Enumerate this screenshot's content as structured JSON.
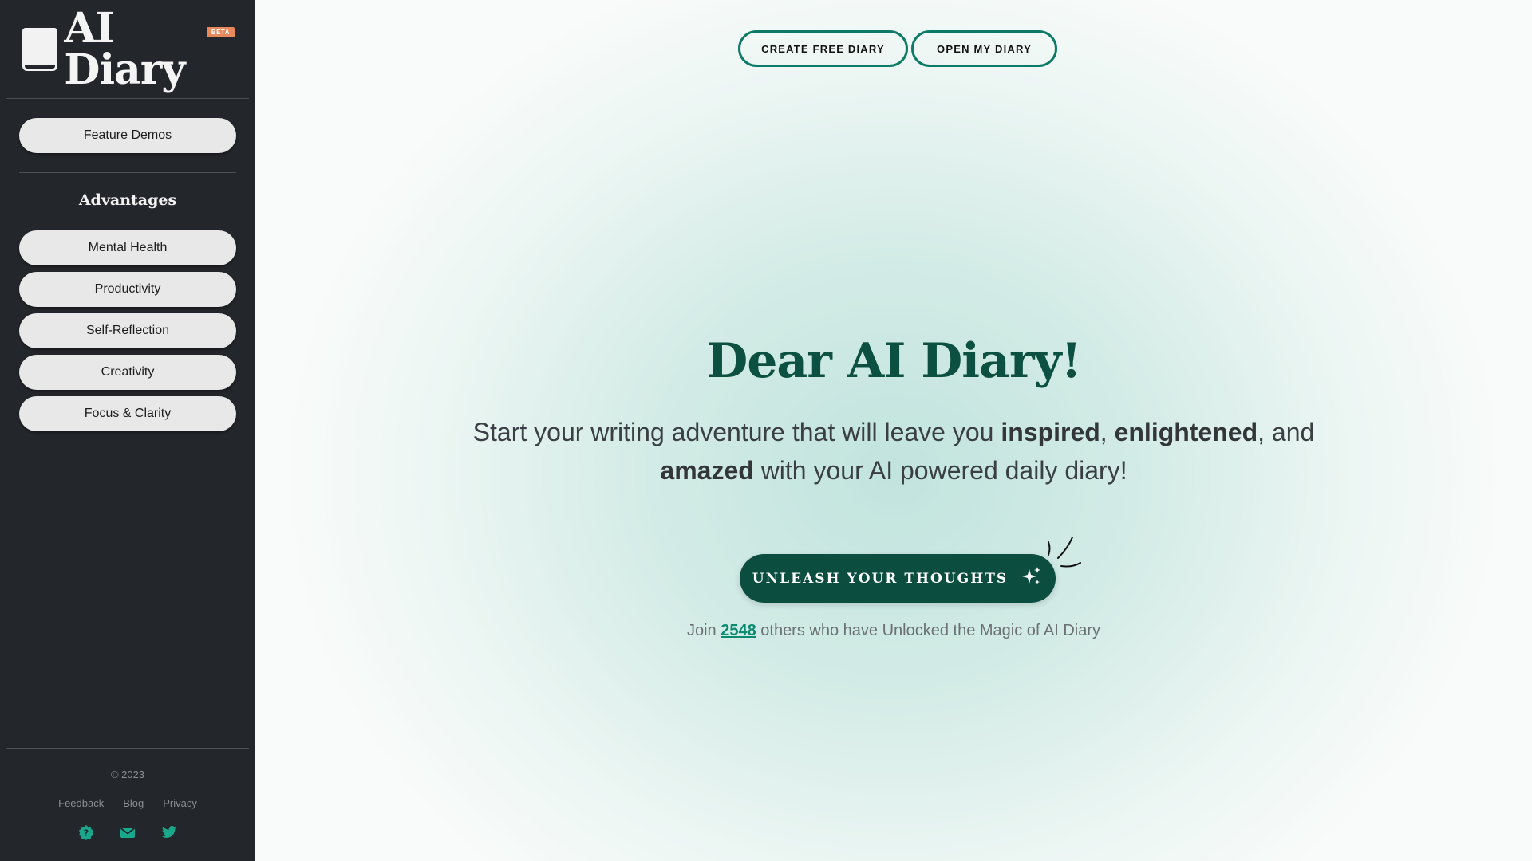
{
  "sidebar": {
    "logo_text": "AI Diary",
    "beta_badge": "BETA",
    "feature_demos_label": "Feature Demos",
    "advantages_heading": "Advantages",
    "advantages": [
      {
        "label": "Mental Health"
      },
      {
        "label": "Productivity"
      },
      {
        "label": "Self-Reflection"
      },
      {
        "label": "Creativity"
      },
      {
        "label": "Focus & Clarity"
      }
    ],
    "copyright": "© 2023",
    "footer_links": [
      {
        "label": "Feedback"
      },
      {
        "label": "Blog"
      },
      {
        "label": "Privacy"
      }
    ],
    "footer_icons": [
      "help-badge-icon",
      "email-icon",
      "twitter-icon"
    ]
  },
  "header": {
    "create_label": "CREATE FREE DIARY",
    "open_label": "OPEN MY DIARY"
  },
  "hero": {
    "title": "Dear AI Diary!",
    "subtitle_parts": {
      "p1": "Start your writing adventure that will leave you ",
      "b1": "inspired",
      "p2": ", ",
      "b2": "enlightened",
      "p3": ", and ",
      "b3": "amazed",
      "p4": " with your AI powered daily diary!"
    },
    "cta_label": "UNLEASH YOUR THOUGHTS",
    "join_prefix": "Join ",
    "join_count": "2548",
    "join_suffix": " others who have Unlocked the Magic of AI Diary"
  },
  "colors": {
    "sidebar_bg": "#23262a",
    "accent": "#0b7a66",
    "cta_bg": "#0b4d3f",
    "title": "#0b5040",
    "beta": "#e8885b",
    "link": "#0b8a72"
  }
}
